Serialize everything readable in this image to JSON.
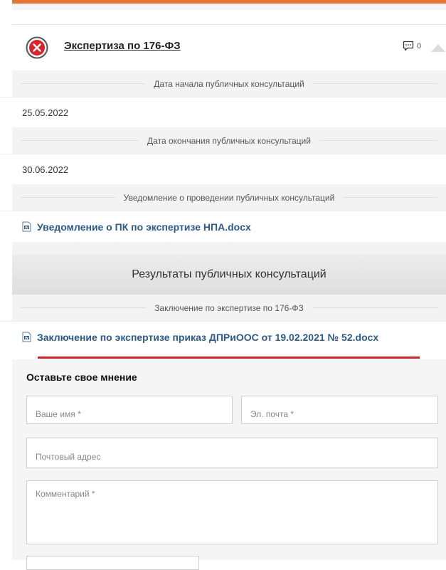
{
  "header": {
    "title": "Экспертиза по 176-ФЗ",
    "comment_count": "0"
  },
  "sections": {
    "start_label": "Дата начала публичных консультаций",
    "start_value": "25.05.2022",
    "end_label": "Дата окончания публичных консультаций",
    "end_value": "30.06.2022",
    "notice_label": "Уведомление о проведении публичных консультаций",
    "notice_file": "Уведомление о ПК по экспертизе НПА.docx",
    "results_title": "Результаты публичных консультаций",
    "conclusion_label": "Заключение по экспертизе по 176-ФЗ",
    "conclusion_file": "Заключение по экспертизе приказ ДПРиООС от 19.02.2021 № 52.docx"
  },
  "form": {
    "title": "Оставьте свое мнение",
    "name_placeholder": "Ваше имя *",
    "email_placeholder": "Эл. почта *",
    "address_placeholder": "Почтовый адрес",
    "comment_placeholder": "Комментарий *"
  },
  "colors": {
    "accent_orange": "#e8742e",
    "close_red": "#e31e24",
    "link_blue": "#2a5a92",
    "highlight_red": "#e31e24"
  },
  "icons": [
    "close-circle-icon",
    "comment-icon",
    "chevron-up-icon",
    "word-doc-icon"
  ]
}
